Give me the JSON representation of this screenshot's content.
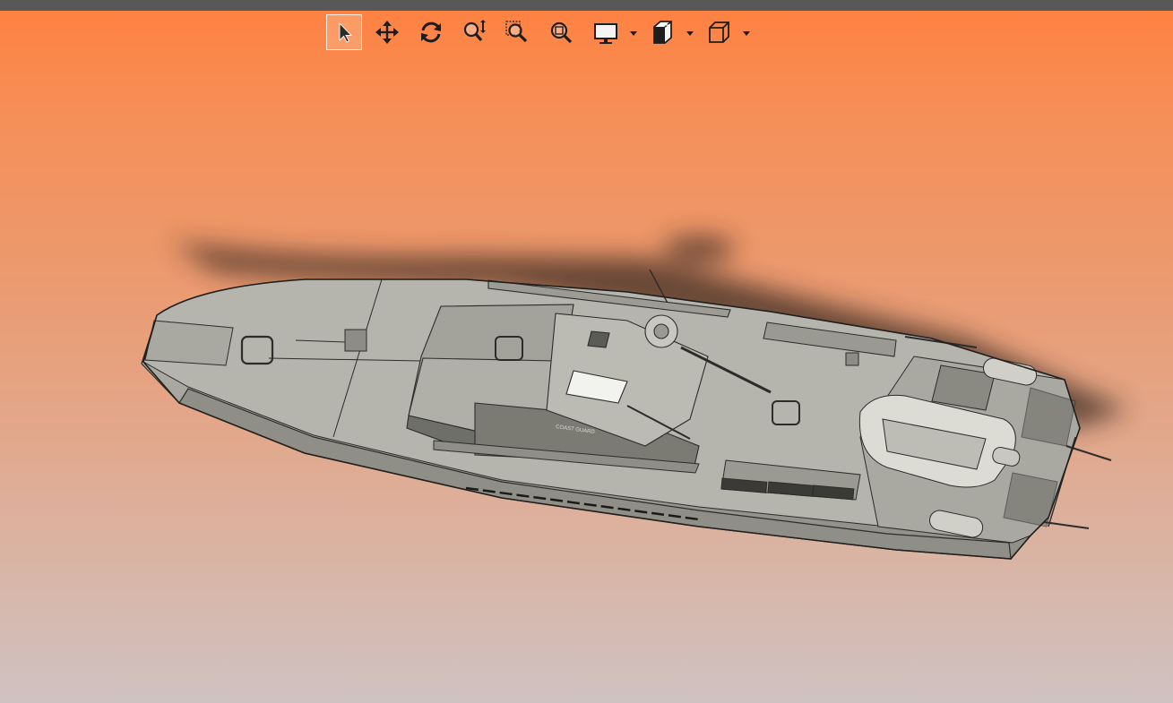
{
  "window": {
    "top_bar_color": "#585858"
  },
  "background": {
    "top_color": "#ff8140",
    "bottom_color": "#cfc2c2"
  },
  "toolbar": {
    "buttons": [
      {
        "id": "select",
        "icon": "select-arrow-icon",
        "active": true
      },
      {
        "id": "pan",
        "icon": "pan-move-icon",
        "active": false
      },
      {
        "id": "rotate",
        "icon": "rotate-icon",
        "active": false
      },
      {
        "id": "zoom",
        "icon": "zoom-icon",
        "active": false
      },
      {
        "id": "zoom-window",
        "icon": "zoom-to-area-icon",
        "active": false
      },
      {
        "id": "zoom-fit",
        "icon": "zoom-to-fit-icon",
        "active": false
      },
      {
        "id": "display-style",
        "icon": "display-style-icon",
        "has_dropdown": true
      },
      {
        "id": "section-view",
        "icon": "section-view-icon",
        "has_dropdown": true
      },
      {
        "id": "view-orientation",
        "icon": "view-cube-icon",
        "has_dropdown": true
      }
    ]
  },
  "model": {
    "hull_color": "#a4a49c",
    "deck_color": "#b7b7af",
    "line_color": "#2c2c2a",
    "shadow_color": "#3a2a20",
    "hull_marking": "COAST GUARD"
  }
}
